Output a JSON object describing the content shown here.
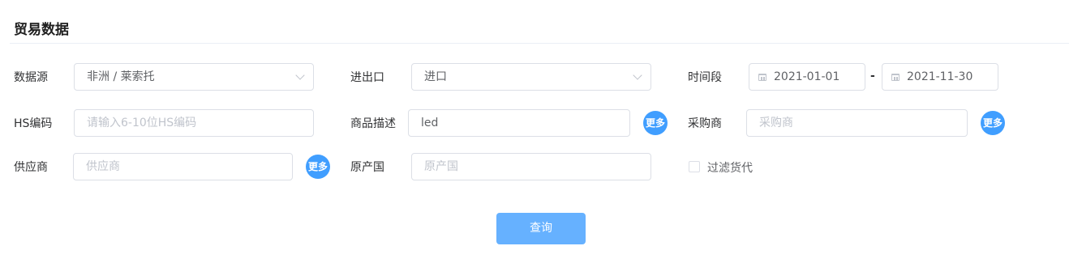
{
  "title": "贸易数据",
  "fields": {
    "data_source": {
      "label": "数据源",
      "value": "非洲 / 莱索托"
    },
    "import_export": {
      "label": "进出口",
      "value": "进口"
    },
    "time_range": {
      "label": "时间段",
      "start": "2021-01-01",
      "separator": "-",
      "end": "2021-11-30"
    },
    "hs_code": {
      "label": "HS编码",
      "placeholder": "请输入6-10位HS编码"
    },
    "product_desc": {
      "label": "商品描述",
      "value": "led",
      "more_label": "更多"
    },
    "buyer": {
      "label": "采购商",
      "placeholder": "采购商",
      "more_label": "更多"
    },
    "supplier": {
      "label": "供应商",
      "placeholder": "供应商",
      "more_label": "更多"
    },
    "origin_country": {
      "label": "原产国",
      "placeholder": "原产国"
    },
    "filter_forwarder": {
      "label": "过滤货代",
      "checked": false
    }
  },
  "query_button": "查询",
  "colors": {
    "accent": "#409eff",
    "button": "#66b1ff",
    "border": "#dcdfe6",
    "placeholder": "#c0c4cc"
  }
}
